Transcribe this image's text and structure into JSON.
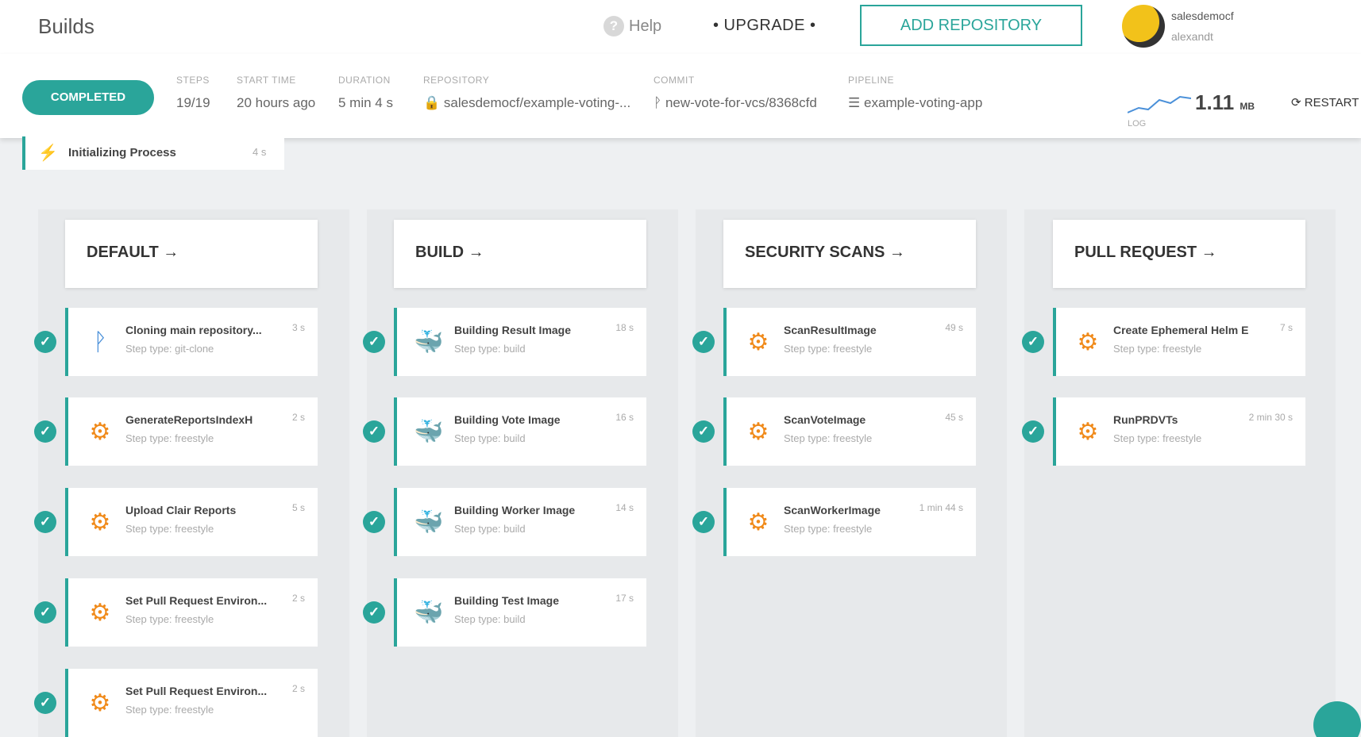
{
  "header": {
    "title": "Builds",
    "help_label": "Help",
    "help_icon": "?",
    "upgrade_label": "• UPGRADE •",
    "add_repository_label": "ADD REPOSITORY",
    "user_name": "salesdemocf",
    "user_sub": "alexandt"
  },
  "build": {
    "status": "COMPLETED",
    "steps_label": "STEPS",
    "steps_value": "19/19",
    "start_label": "START TIME",
    "start_value": "20 hours ago",
    "duration_label": "DURATION",
    "duration_value": "5 min 4 s",
    "repository_label": "REPOSITORY",
    "repository_value": "salesdemocf/example-voting-...",
    "commit_label": "COMMIT",
    "commit_value": "new-vote-for-vcs/8368cfd",
    "pipeline_label": "PIPELINE",
    "pipeline_value": "example-voting-app",
    "log_label": "LOG",
    "log_size": "1.11",
    "log_unit": "MB",
    "restart_label": "RESTART"
  },
  "init": {
    "name": "Initializing Process",
    "time": "4 s"
  },
  "stages": [
    {
      "title": "DEFAULT →",
      "steps": [
        {
          "name": "Cloning main repository...",
          "type": "Step type: git-clone",
          "time": "3 s",
          "icon": "git-icon"
        },
        {
          "name": "GenerateReportsIndexH",
          "type": "Step type: freestyle",
          "time": "2 s",
          "icon": "gear-icon"
        },
        {
          "name": "Upload Clair Reports",
          "type": "Step type: freestyle",
          "time": "5 s",
          "icon": "gear-icon"
        },
        {
          "name": "Set Pull Request Environ...",
          "type": "Step type: freestyle",
          "time": "2 s",
          "icon": "gear-icon"
        },
        {
          "name": "Set Pull Request Environ...",
          "type": "Step type: freestyle",
          "time": "2 s",
          "icon": "gear-icon"
        }
      ]
    },
    {
      "title": "BUILD →",
      "steps": [
        {
          "name": "Building Result Image",
          "type": "Step type: build",
          "time": "18 s",
          "icon": "docker-icon"
        },
        {
          "name": "Building Vote Image",
          "type": "Step type: build",
          "time": "16 s",
          "icon": "docker-icon"
        },
        {
          "name": "Building Worker Image",
          "type": "Step type: build",
          "time": "14 s",
          "icon": "docker-icon"
        },
        {
          "name": "Building Test Image",
          "type": "Step type: build",
          "time": "17 s",
          "icon": "docker-icon"
        }
      ]
    },
    {
      "title": "SECURITY SCANS →",
      "steps": [
        {
          "name": "ScanResultImage",
          "type": "Step type: freestyle",
          "time": "49 s",
          "icon": "gear-icon"
        },
        {
          "name": "ScanVoteImage",
          "type": "Step type: freestyle",
          "time": "45 s",
          "icon": "gear-icon"
        },
        {
          "name": "ScanWorkerImage",
          "type": "Step type: freestyle",
          "time": "1 min 44 s",
          "icon": "gear-icon"
        }
      ]
    },
    {
      "title": "PULL REQUEST →",
      "steps": [
        {
          "name": "Create Ephemeral Helm E",
          "type": "Step type: freestyle",
          "time": "7 s",
          "icon": "gear-icon"
        },
        {
          "name": "RunPRDVTs",
          "type": "Step type: freestyle",
          "time": "2 min 30 s",
          "icon": "gear-icon"
        }
      ]
    }
  ],
  "colors": {
    "accent": "#2aa59a",
    "gear": "#f08a1a",
    "docker": "#2f8bd6"
  }
}
